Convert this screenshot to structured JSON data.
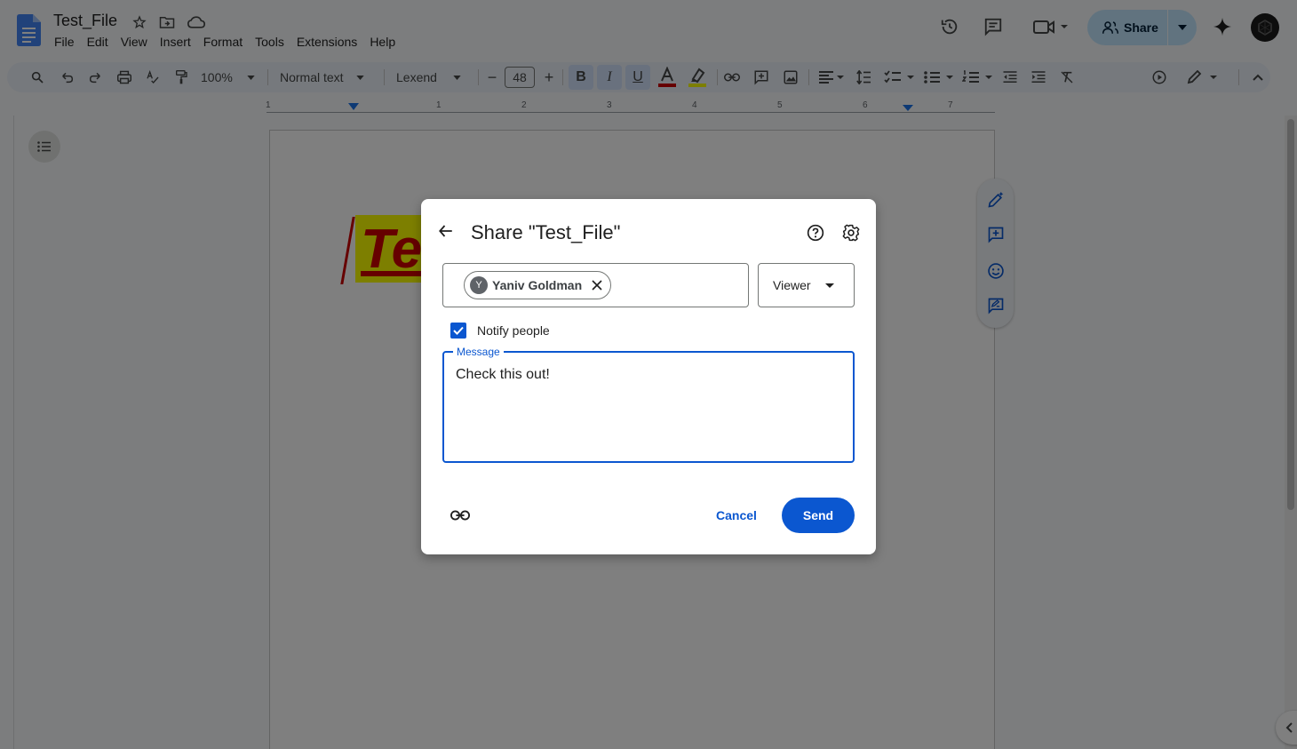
{
  "app": {
    "doc_title": "Test_File",
    "menu": [
      "File",
      "Edit",
      "View",
      "Insert",
      "Format",
      "Tools",
      "Extensions",
      "Help"
    ],
    "share_label": "Share"
  },
  "toolbar": {
    "zoom": "100%",
    "style": "Normal text",
    "font": "Lexend",
    "font_size": "48",
    "minus": "−",
    "plus": "+",
    "bold": "B",
    "italic": "I",
    "underline": "U",
    "text_color": "#cc0000",
    "highlight_color": "#fbff00"
  },
  "ruler": {
    "numbers": [
      "1",
      "1",
      "2",
      "3",
      "4",
      "5",
      "6",
      "7"
    ]
  },
  "document": {
    "visible_text": "Te"
  },
  "dialog": {
    "title": "Share \"Test_File\"",
    "chip_initial": "Y",
    "chip_name": "Yaniv Goldman",
    "role": "Viewer",
    "notify_label": "Notify people",
    "notify_checked": true,
    "message_label": "Message",
    "message_text": "Check this out!",
    "cancel_label": "Cancel",
    "send_label": "Send",
    "accent_color": "#0b57d0"
  }
}
